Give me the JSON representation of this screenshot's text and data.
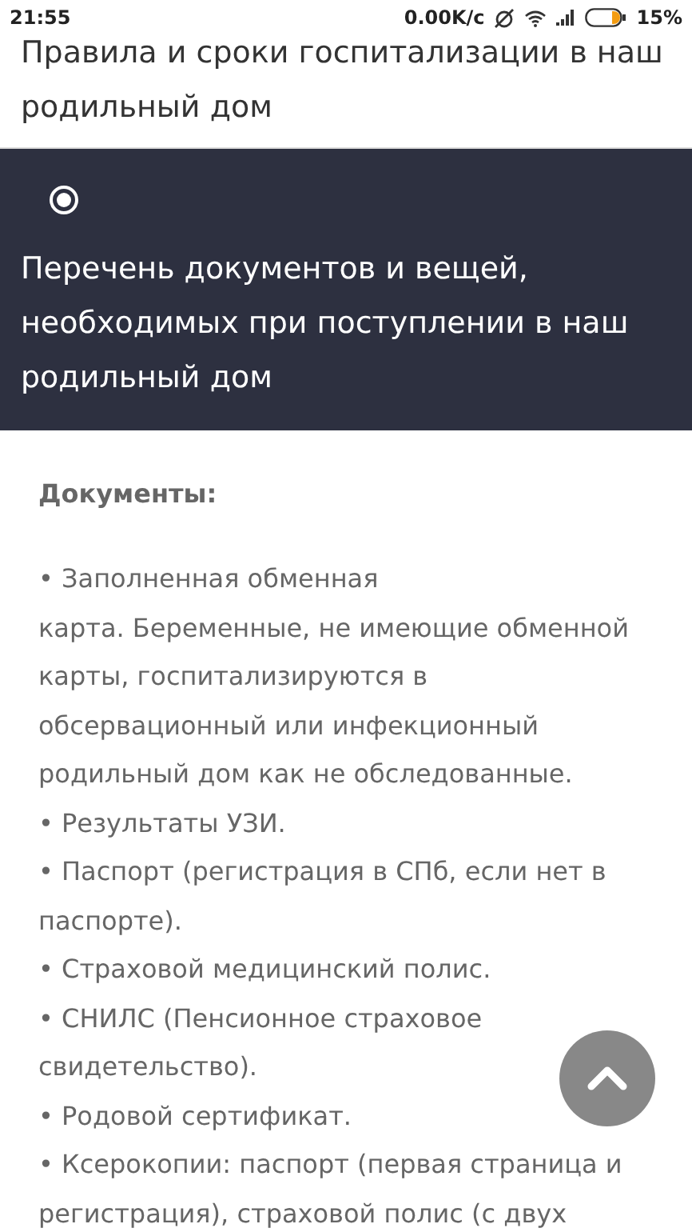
{
  "status_bar": {
    "time": "21:55",
    "speed": "0.00K/c",
    "battery": "15%"
  },
  "header": {
    "title_lines": [
      "Правила и сроки госпитализации в наш",
      "родильный дом"
    ]
  },
  "section": {
    "expanded": true,
    "title_lines": [
      "Перечень документов и вещей,",
      "необходимых при поступлении в наш",
      "родильный дом"
    ]
  },
  "content": {
    "heading": "Документы:",
    "items": [
      {
        "lines": [
          "• Заполненная обменная",
          "карта. Беременные, не имеющие обменной",
          "карты, госпитализируются в",
          "обсервационный или инфекционный",
          "родильный дом как не обследованные."
        ]
      },
      {
        "lines": [
          "• Результаты УЗИ."
        ]
      },
      {
        "lines": [
          "• Паспорт (регистрация в СПб, если нет в",
          "паспорте)."
        ]
      },
      {
        "lines": [
          "• Страховой медицинский полис."
        ]
      },
      {
        "lines": [
          "• СНИЛС (Пенсионное страховое",
          "свидетельство)."
        ]
      },
      {
        "lines": [
          "• Родовой сертификат."
        ]
      },
      {
        "lines": [
          "• Ксерокопии: паспорт (первая страница и",
          "регистрация), страховой полис (с двух"
        ]
      }
    ]
  }
}
